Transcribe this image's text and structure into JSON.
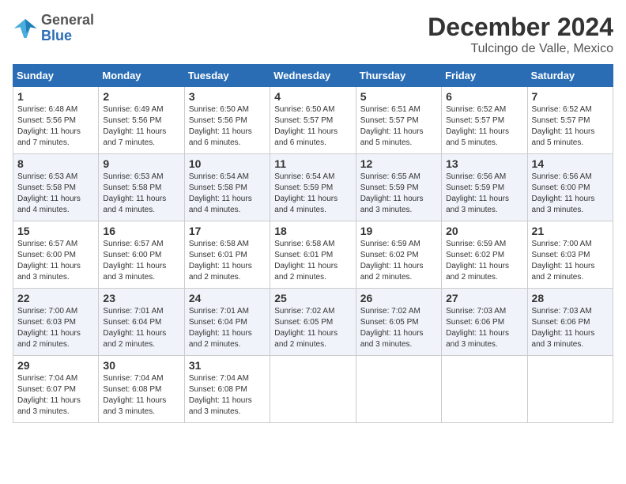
{
  "logo": {
    "general": "General",
    "blue": "Blue"
  },
  "title": "December 2024",
  "location": "Tulcingo de Valle, Mexico",
  "weekdays": [
    "Sunday",
    "Monday",
    "Tuesday",
    "Wednesday",
    "Thursday",
    "Friday",
    "Saturday"
  ],
  "weeks": [
    [
      {
        "day": "1",
        "info": "Sunrise: 6:48 AM\nSunset: 5:56 PM\nDaylight: 11 hours and 7 minutes."
      },
      {
        "day": "2",
        "info": "Sunrise: 6:49 AM\nSunset: 5:56 PM\nDaylight: 11 hours and 7 minutes."
      },
      {
        "day": "3",
        "info": "Sunrise: 6:50 AM\nSunset: 5:56 PM\nDaylight: 11 hours and 6 minutes."
      },
      {
        "day": "4",
        "info": "Sunrise: 6:50 AM\nSunset: 5:57 PM\nDaylight: 11 hours and 6 minutes."
      },
      {
        "day": "5",
        "info": "Sunrise: 6:51 AM\nSunset: 5:57 PM\nDaylight: 11 hours and 5 minutes."
      },
      {
        "day": "6",
        "info": "Sunrise: 6:52 AM\nSunset: 5:57 PM\nDaylight: 11 hours and 5 minutes."
      },
      {
        "day": "7",
        "info": "Sunrise: 6:52 AM\nSunset: 5:57 PM\nDaylight: 11 hours and 5 minutes."
      }
    ],
    [
      {
        "day": "8",
        "info": "Sunrise: 6:53 AM\nSunset: 5:58 PM\nDaylight: 11 hours and 4 minutes."
      },
      {
        "day": "9",
        "info": "Sunrise: 6:53 AM\nSunset: 5:58 PM\nDaylight: 11 hours and 4 minutes."
      },
      {
        "day": "10",
        "info": "Sunrise: 6:54 AM\nSunset: 5:58 PM\nDaylight: 11 hours and 4 minutes."
      },
      {
        "day": "11",
        "info": "Sunrise: 6:54 AM\nSunset: 5:59 PM\nDaylight: 11 hours and 4 minutes."
      },
      {
        "day": "12",
        "info": "Sunrise: 6:55 AM\nSunset: 5:59 PM\nDaylight: 11 hours and 3 minutes."
      },
      {
        "day": "13",
        "info": "Sunrise: 6:56 AM\nSunset: 5:59 PM\nDaylight: 11 hours and 3 minutes."
      },
      {
        "day": "14",
        "info": "Sunrise: 6:56 AM\nSunset: 6:00 PM\nDaylight: 11 hours and 3 minutes."
      }
    ],
    [
      {
        "day": "15",
        "info": "Sunrise: 6:57 AM\nSunset: 6:00 PM\nDaylight: 11 hours and 3 minutes."
      },
      {
        "day": "16",
        "info": "Sunrise: 6:57 AM\nSunset: 6:00 PM\nDaylight: 11 hours and 3 minutes."
      },
      {
        "day": "17",
        "info": "Sunrise: 6:58 AM\nSunset: 6:01 PM\nDaylight: 11 hours and 2 minutes."
      },
      {
        "day": "18",
        "info": "Sunrise: 6:58 AM\nSunset: 6:01 PM\nDaylight: 11 hours and 2 minutes."
      },
      {
        "day": "19",
        "info": "Sunrise: 6:59 AM\nSunset: 6:02 PM\nDaylight: 11 hours and 2 minutes."
      },
      {
        "day": "20",
        "info": "Sunrise: 6:59 AM\nSunset: 6:02 PM\nDaylight: 11 hours and 2 minutes."
      },
      {
        "day": "21",
        "info": "Sunrise: 7:00 AM\nSunset: 6:03 PM\nDaylight: 11 hours and 2 minutes."
      }
    ],
    [
      {
        "day": "22",
        "info": "Sunrise: 7:00 AM\nSunset: 6:03 PM\nDaylight: 11 hours and 2 minutes."
      },
      {
        "day": "23",
        "info": "Sunrise: 7:01 AM\nSunset: 6:04 PM\nDaylight: 11 hours and 2 minutes."
      },
      {
        "day": "24",
        "info": "Sunrise: 7:01 AM\nSunset: 6:04 PM\nDaylight: 11 hours and 2 minutes."
      },
      {
        "day": "25",
        "info": "Sunrise: 7:02 AM\nSunset: 6:05 PM\nDaylight: 11 hours and 2 minutes."
      },
      {
        "day": "26",
        "info": "Sunrise: 7:02 AM\nSunset: 6:05 PM\nDaylight: 11 hours and 3 minutes."
      },
      {
        "day": "27",
        "info": "Sunrise: 7:03 AM\nSunset: 6:06 PM\nDaylight: 11 hours and 3 minutes."
      },
      {
        "day": "28",
        "info": "Sunrise: 7:03 AM\nSunset: 6:06 PM\nDaylight: 11 hours and 3 minutes."
      }
    ],
    [
      {
        "day": "29",
        "info": "Sunrise: 7:04 AM\nSunset: 6:07 PM\nDaylight: 11 hours and 3 minutes."
      },
      {
        "day": "30",
        "info": "Sunrise: 7:04 AM\nSunset: 6:08 PM\nDaylight: 11 hours and 3 minutes."
      },
      {
        "day": "31",
        "info": "Sunrise: 7:04 AM\nSunset: 6:08 PM\nDaylight: 11 hours and 3 minutes."
      },
      {
        "day": "",
        "info": ""
      },
      {
        "day": "",
        "info": ""
      },
      {
        "day": "",
        "info": ""
      },
      {
        "day": "",
        "info": ""
      }
    ]
  ]
}
